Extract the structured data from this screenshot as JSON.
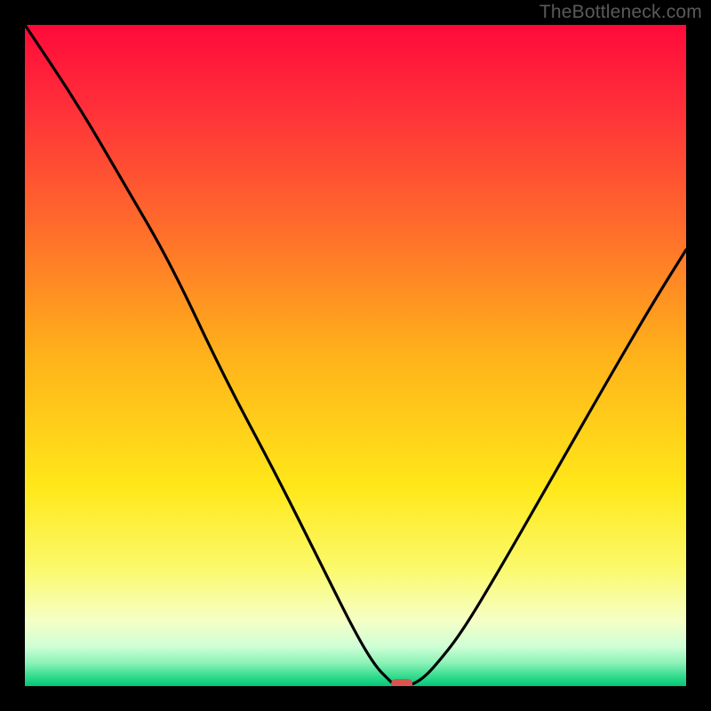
{
  "attribution": "TheBottleneck.com",
  "chart_data": {
    "type": "line",
    "title": "",
    "xlabel": "",
    "ylabel": "",
    "xlim": [
      0,
      100
    ],
    "ylim": [
      0,
      100
    ],
    "series": [
      {
        "name": "bottleneck-curve",
        "x": [
          0,
          8,
          15,
          22,
          30,
          38,
          45,
          50,
          53,
          55,
          56,
          57,
          58,
          60,
          62,
          66,
          72,
          80,
          88,
          95,
          100
        ],
        "values": [
          100,
          88,
          76,
          64,
          47,
          32,
          18,
          8,
          3,
          1,
          0,
          0,
          0,
          1,
          3,
          8,
          18,
          32,
          46,
          58,
          66
        ]
      }
    ],
    "marker": {
      "x": 57,
      "y": 0,
      "color": "#d9534f"
    },
    "gradient_stops": [
      {
        "offset": 0.0,
        "color": "#ff0a3a"
      },
      {
        "offset": 0.12,
        "color": "#ff2e3a"
      },
      {
        "offset": 0.3,
        "color": "#ff6a2c"
      },
      {
        "offset": 0.5,
        "color": "#ffb21a"
      },
      {
        "offset": 0.7,
        "color": "#ffe81a"
      },
      {
        "offset": 0.82,
        "color": "#fbf96a"
      },
      {
        "offset": 0.9,
        "color": "#f6ffc5"
      },
      {
        "offset": 0.94,
        "color": "#cfffd6"
      },
      {
        "offset": 0.965,
        "color": "#8cf2b7"
      },
      {
        "offset": 0.985,
        "color": "#35dc8e"
      },
      {
        "offset": 1.0,
        "color": "#00c776"
      }
    ]
  }
}
